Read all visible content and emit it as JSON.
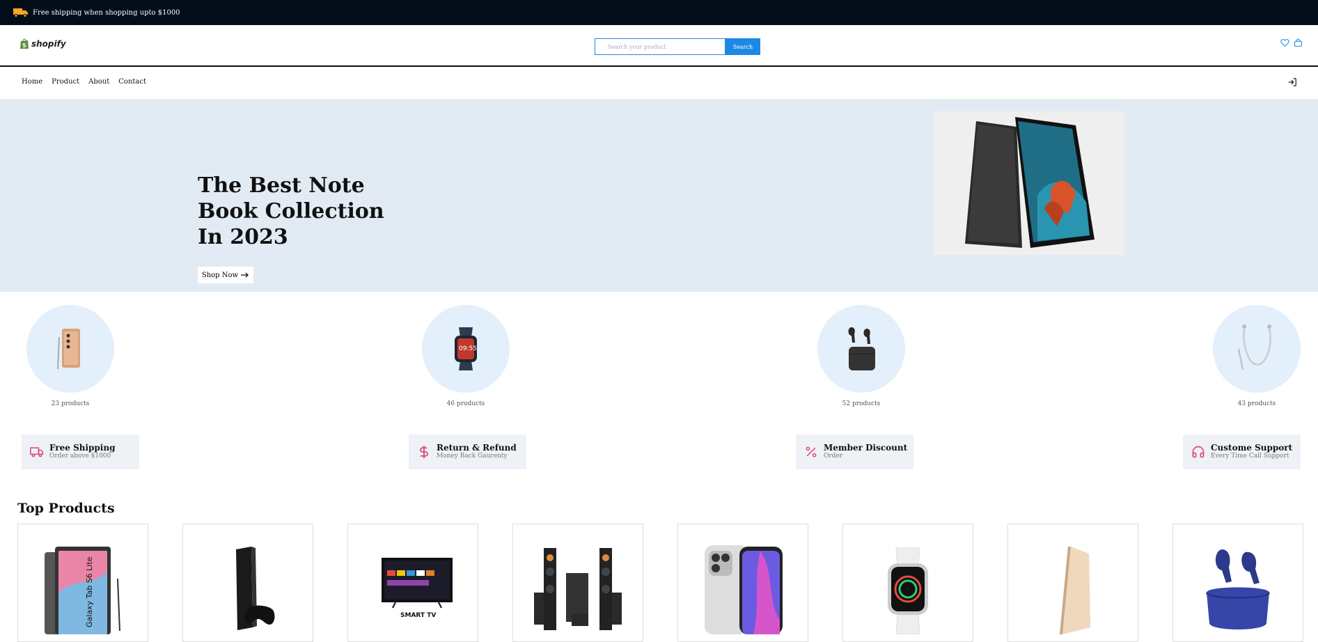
{
  "topbar": {
    "text": "Free shipping when shopping upto $1000",
    "icon": "truck-icon"
  },
  "header": {
    "logo_text": "shopify",
    "search_placeholder": "Search your product",
    "search_button": "Search",
    "icons": [
      "heart-icon",
      "cart-icon"
    ]
  },
  "nav": {
    "items": [
      {
        "label": "Home"
      },
      {
        "label": "Product"
      },
      {
        "label": "About"
      },
      {
        "label": "Contact"
      }
    ],
    "login_icon": "login-icon"
  },
  "hero": {
    "title": "The Best Note Book Collection In 2023",
    "button": "Shop Now",
    "button_icon": "arrow-right-icon",
    "image": "tablet-image"
  },
  "categories": [
    {
      "count": "23 products",
      "image": "phone-image"
    },
    {
      "count": "46 products",
      "image": "smartwatch-image"
    },
    {
      "count": "52 products",
      "image": "earbuds-image"
    },
    {
      "count": "43 products",
      "image": "neckband-image"
    }
  ],
  "features": [
    {
      "title": "Free Shipping",
      "subtitle": "Order above $1000",
      "icon": "truck-icon"
    },
    {
      "title": "Return & Refund",
      "subtitle": "Money Back Gaurenty",
      "icon": "dollar-icon"
    },
    {
      "title": "Member Discount",
      "subtitle": "Order",
      "icon": "percent-icon"
    },
    {
      "title": "Custome Support",
      "subtitle": "Every Time Call Support",
      "icon": "headphones-icon"
    }
  ],
  "top_products": {
    "title": "Top Products",
    "items": [
      {
        "image": "galaxy-tab-image",
        "label": "Galaxy Tab S6 Lite"
      },
      {
        "image": "playstation-image"
      },
      {
        "image": "smart-tv-image",
        "label": "SMART TV"
      },
      {
        "image": "speaker-system-image"
      },
      {
        "image": "iphone-image"
      },
      {
        "image": "apple-watch-image"
      },
      {
        "image": "macbook-image"
      },
      {
        "image": "earbuds-image"
      }
    ]
  },
  "colors": {
    "topbar": "#030d1a",
    "accent": "#1e88e5",
    "hero_bg": "#e2ebf3",
    "feature_icon": "#e0457b"
  }
}
